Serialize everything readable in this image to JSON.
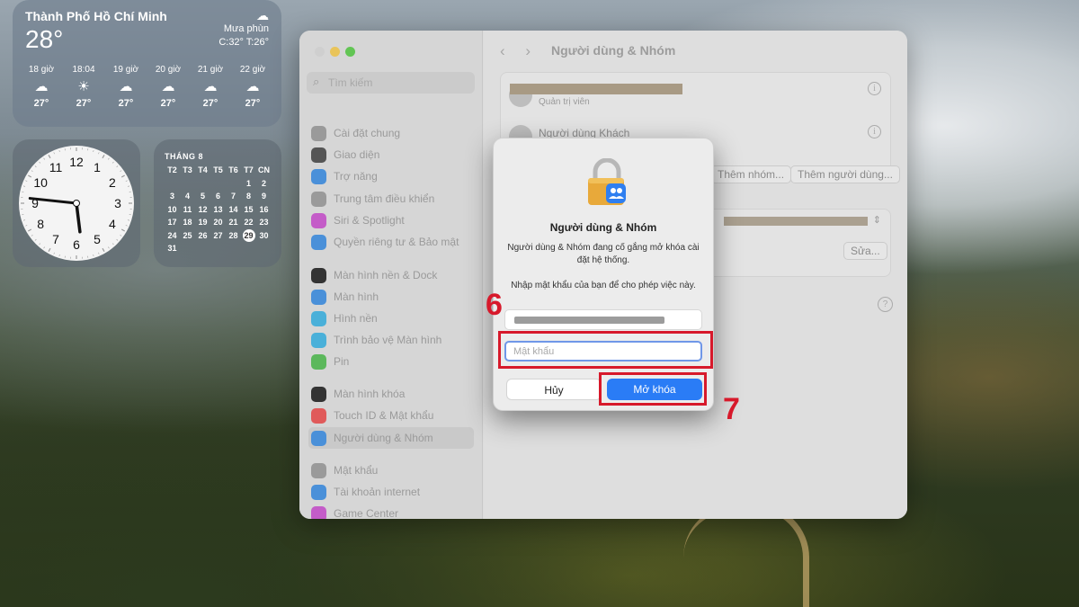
{
  "weather": {
    "city": "Thành Phố Hồ Chí Minh",
    "temp": "28°",
    "condition": "Mưa phùn",
    "range": "C:32° T:26°",
    "hours": [
      {
        "time": "18 giờ",
        "icon": "rain-cloud-icon",
        "temp": "27°"
      },
      {
        "time": "18:04",
        "icon": "sunset-icon",
        "temp": "27°"
      },
      {
        "time": "19 giờ",
        "icon": "rain-cloud-icon",
        "temp": "27°"
      },
      {
        "time": "20 giờ",
        "icon": "rain-cloud-icon",
        "temp": "27°"
      },
      {
        "time": "21 giờ",
        "icon": "rain-cloud-icon",
        "temp": "27°"
      },
      {
        "time": "22 giờ",
        "icon": "rain-cloud-icon",
        "temp": "27°"
      }
    ]
  },
  "clock": {
    "numbers": [
      "12",
      "1",
      "2",
      "3",
      "4",
      "5",
      "6",
      "7",
      "8",
      "9",
      "10",
      "11"
    ],
    "hour": 5,
    "minute": 46
  },
  "calendar": {
    "month": "THÁNG 8",
    "weekdays": [
      "T2",
      "T3",
      "T4",
      "T5",
      "T6",
      "T7",
      "CN"
    ],
    "weeks": [
      [
        "",
        "",
        "",
        "",
        "",
        "1",
        "2"
      ],
      [
        "3",
        "4",
        "5",
        "6",
        "7",
        "8",
        "9"
      ],
      [
        "10",
        "11",
        "12",
        "13",
        "14",
        "15",
        "16"
      ],
      [
        "17",
        "18",
        "19",
        "20",
        "21",
        "22",
        "23"
      ],
      [
        "24",
        "25",
        "26",
        "27",
        "28",
        "29",
        "30"
      ],
      [
        "31",
        "",
        "",
        "",
        "",
        "",
        ""
      ]
    ],
    "today": "29"
  },
  "sidebar": {
    "search_placeholder": "Tìm kiếm",
    "items": [
      {
        "label": "Cài đặt chung",
        "icon": "gear-icon",
        "color": "#9a9a9a"
      },
      {
        "label": "Giao diện",
        "icon": "appearance-icon",
        "color": "#555555"
      },
      {
        "label": "Trợ năng",
        "icon": "accessibility-icon",
        "color": "#4a90d9"
      },
      {
        "label": "Trung tâm điều khiển",
        "icon": "control-center-icon",
        "color": "#9a9a9a"
      },
      {
        "label": "Siri & Spotlight",
        "icon": "siri-icon",
        "color": "#c45cc8"
      },
      {
        "label": "Quyền riêng tư & Bảo mật",
        "icon": "hand-icon",
        "color": "#4a90d9"
      },
      {
        "label": "Màn hình nền & Dock",
        "icon": "dock-icon",
        "color": "#333333"
      },
      {
        "label": "Màn hình",
        "icon": "display-icon",
        "color": "#4a90d9"
      },
      {
        "label": "Hình nền",
        "icon": "wallpaper-icon",
        "color": "#4ab0d9"
      },
      {
        "label": "Trình bảo vệ Màn hình",
        "icon": "screensaver-icon",
        "color": "#4ab0d9"
      },
      {
        "label": "Pin",
        "icon": "battery-icon",
        "color": "#5cb85c"
      },
      {
        "label": "Màn hình khóa",
        "icon": "lock-screen-icon",
        "color": "#333333"
      },
      {
        "label": "Touch ID & Mật khẩu",
        "icon": "fingerprint-icon",
        "color": "#e05a5a"
      },
      {
        "label": "Người dùng & Nhóm",
        "icon": "users-icon",
        "color": "#4a90d9"
      },
      {
        "label": "Mật khẩu",
        "icon": "key-icon",
        "color": "#9a9a9a"
      },
      {
        "label": "Tài khoản internet",
        "icon": "at-icon",
        "color": "#4a90d9"
      },
      {
        "label": "Game Center",
        "icon": "game-center-icon",
        "color": "#c45cc8"
      }
    ]
  },
  "main": {
    "title": "Người dùng & Nhóm",
    "admin_role": "Quản trị viên",
    "guest_user": "Người dùng Khách",
    "add_group": "Thêm nhóm...",
    "add_user": "Thêm người dùng...",
    "edit": "Sửa...",
    "help": "?"
  },
  "dialog": {
    "title": "Người dùng & Nhóm",
    "message": "Người dùng & Nhóm đang cố gắng mở khóa cài đặt hệ thống.",
    "prompt": "Nhập mật khẩu của bạn để cho phép việc này.",
    "password_placeholder": "Mật khẩu",
    "cancel": "Hủy",
    "unlock": "Mở khóa"
  },
  "annotations": {
    "step6": "6",
    "step7": "7"
  },
  "colors": {
    "accent": "#2a7cf6",
    "highlight": "#d7192b"
  }
}
